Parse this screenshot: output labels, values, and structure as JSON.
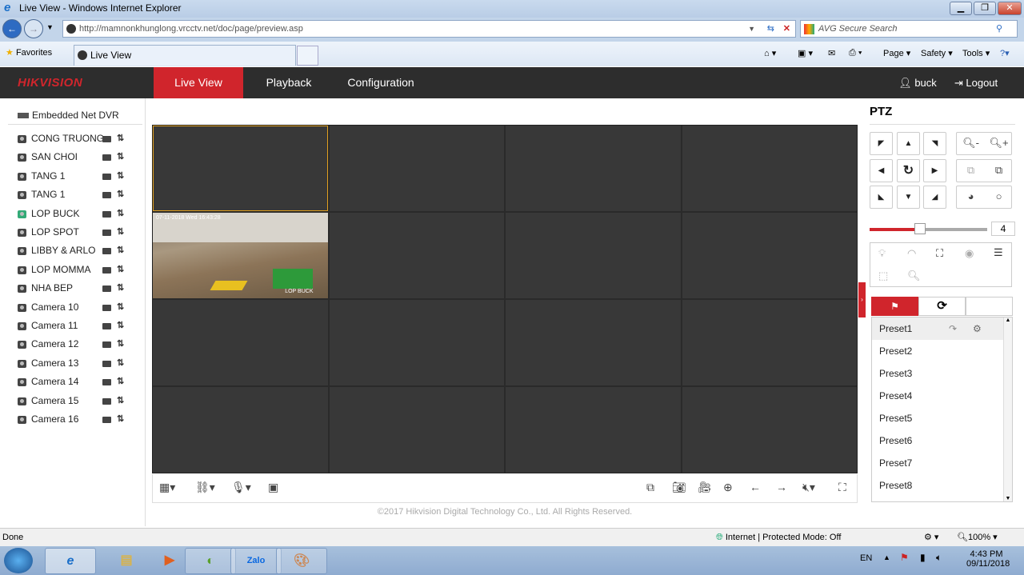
{
  "browser": {
    "title": "Live View - Windows Internet Explorer",
    "url": "http://mamnonkhunglong.vrcctv.net/doc/page/preview.asp",
    "search_placeholder": "AVG Secure Search",
    "favorites": "Favorites",
    "tab": "Live View",
    "page_menu": "Page",
    "safety_menu": "Safety",
    "tools_menu": "Tools"
  },
  "header": {
    "logo": "HIKVISION",
    "nav": [
      "Live View",
      "Playback",
      "Configuration"
    ],
    "user": "buck",
    "logout": "Logout",
    "accent": "#d0252c"
  },
  "device": {
    "name": "Embedded Net DVR",
    "cameras": [
      "CONG TRUONG",
      "SAN CHOI",
      "TANG 1",
      "TANG 1",
      "LOP BUCK",
      "LOP SPOT",
      "LIBBY & ARLO",
      "LOP MOMMA",
      "NHA BEP",
      "Camera 10",
      "Camera 11",
      "Camera 12",
      "Camera 13",
      "Camera 14",
      "Camera 15",
      "Camera 16"
    ]
  },
  "video": {
    "overlay_date": "07-11-2018 Wed 16:43:28",
    "overlay_name": "LOP BUCK"
  },
  "ptz": {
    "title": "PTZ",
    "speed": "4",
    "speed_fraction": 0.43,
    "presets": [
      "Preset1",
      "Preset2",
      "Preset3",
      "Preset4",
      "Preset5",
      "Preset6",
      "Preset7",
      "Preset8"
    ]
  },
  "footer": "©2017 Hikvision Digital Technology Co., Ltd. All Rights Reserved.",
  "status": {
    "left": "Done",
    "zone": "Internet | Protected Mode: Off",
    "zoom": "100%"
  },
  "taskbar": {
    "lang": "EN",
    "time": "4:43 PM",
    "date": "09/11/2018",
    "zalo": "Zalo"
  }
}
